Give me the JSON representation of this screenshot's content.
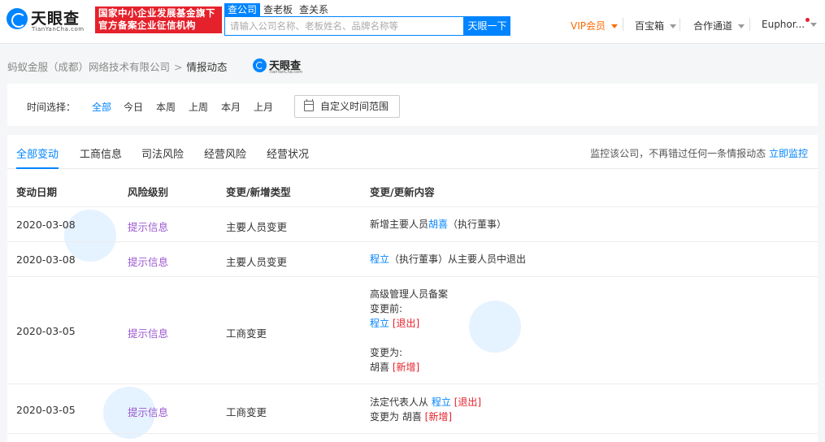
{
  "header": {
    "brand": "天眼查",
    "brand_en": "TianYanCha.com",
    "badge_line1": "国家中小企业发展基金旗下",
    "badge_line2": "官方备案企业征信机构",
    "search_tabs": [
      "查公司",
      "查老板",
      "查关系"
    ],
    "search_placeholder": "请输入公司名称、老板姓名、品牌名称等",
    "search_button": "天眼一下",
    "nav": {
      "vip": "VIP会员",
      "treasure": "百宝箱",
      "cooperate": "合作通道",
      "user": "Euphor..."
    }
  },
  "breadcrumb": {
    "company": "蚂蚁金服（成都）网络技术有限公司",
    "current": "情报动态",
    "mini_brand": "天眼查",
    "mini_brand_en": "TianYanCha.com"
  },
  "time_filter": {
    "label": "时间选择：",
    "options": [
      "全部",
      "今日",
      "本周",
      "上周",
      "本月",
      "上月"
    ],
    "active": "全部",
    "custom": "自定义时间范围"
  },
  "tabs": [
    "全部变动",
    "工商信息",
    "司法风险",
    "经营风险",
    "经营状况"
  ],
  "monitor": {
    "text": "监控该公司，不再错过任何一条情报动态",
    "link": "立即监控"
  },
  "table": {
    "headers": [
      "变动日期",
      "风险级别",
      "变更/新增类型",
      "变更/更新内容"
    ],
    "rows": [
      {
        "date": "2020-03-08",
        "risk": "提示信息",
        "type": "主要人员变更",
        "content": {
          "prefix": "新增主要人员",
          "name": "胡喜",
          "suffix": "（执行董事）"
        }
      },
      {
        "date": "2020-03-08",
        "risk": "提示信息",
        "type": "主要人员变更",
        "content": {
          "name": "程立",
          "suffix": "（执行董事）从主要人员中退出"
        }
      },
      {
        "date": "2020-03-05",
        "risk": "提示信息",
        "type": "工商变更",
        "content": {
          "title": "高级管理人员备案",
          "before_label": "变更前:",
          "before_name": "程立",
          "before_tag": "[退出]",
          "after_label": "变更为:",
          "after_name": "胡喜",
          "after_tag": "[新增]"
        }
      },
      {
        "date": "2020-03-05",
        "risk": "提示信息",
        "type": "工商变更",
        "content": {
          "line1_prefix": "法定代表人从",
          "line1_name": "程立",
          "line1_tag": "[退出]",
          "line2_prefix": "变更为 胡喜",
          "line2_tag": "[新增]"
        }
      }
    ]
  },
  "colors": {
    "primary": "#0084ff",
    "vip": "#ff6a00",
    "risk": "#9b59d0",
    "tag": "#e5212b"
  }
}
